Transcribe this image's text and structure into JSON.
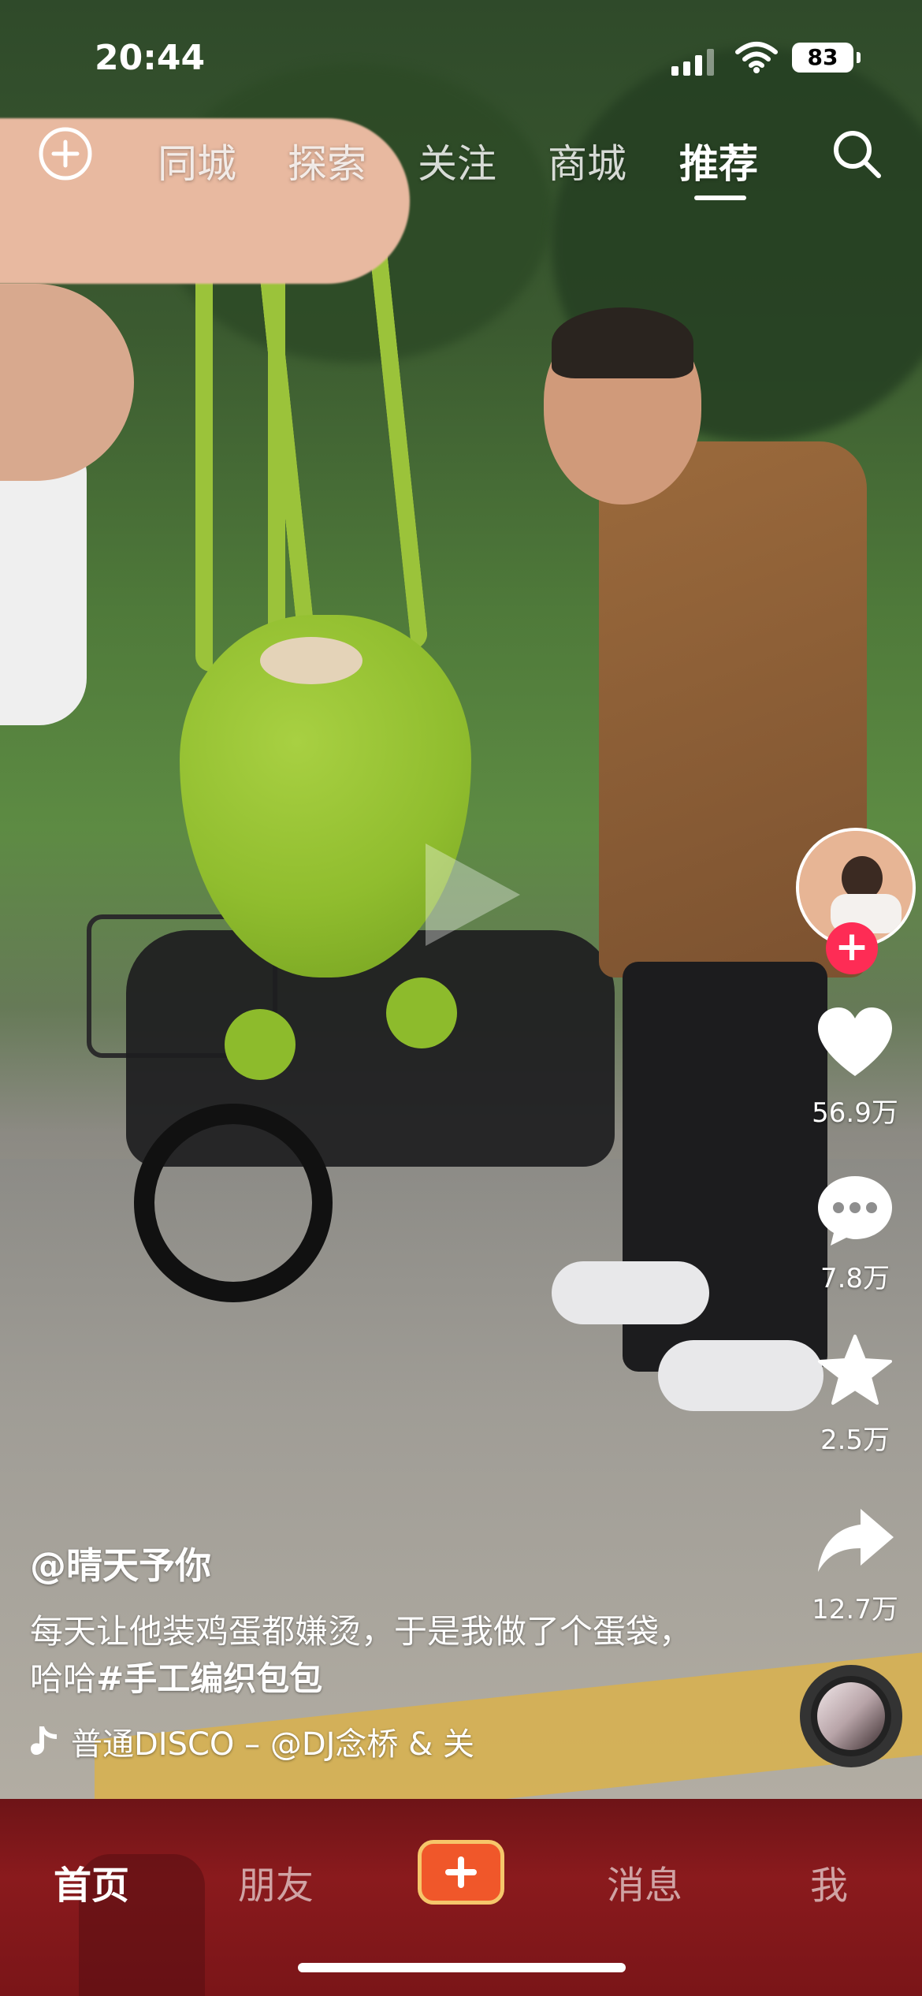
{
  "status_bar": {
    "time": "20:44",
    "battery": "83"
  },
  "top_nav": {
    "tabs": [
      "同城",
      "探索",
      "关注",
      "商城",
      "推荐"
    ],
    "active_tab": "推荐"
  },
  "side_actions": {
    "likes": "56.9万",
    "comments": "7.8万",
    "favorites": "2.5万",
    "shares": "12.7万"
  },
  "post": {
    "username": "@晴天予你",
    "description": "每天让他装鸡蛋都嫌烫，于是我做了个蛋袋，哈哈",
    "hashtag": "#手工编织包包",
    "music": "普通DISCO – @DJ念桥 & 关"
  },
  "bottom_nav": {
    "home": "首页",
    "friends": "朋友",
    "messages": "消息",
    "me": "我"
  },
  "colors": {
    "accent": "#fe2c55",
    "create_button": "#f0572a",
    "create_border": "#f6c66a",
    "bottom_bar": "#7a1518"
  }
}
